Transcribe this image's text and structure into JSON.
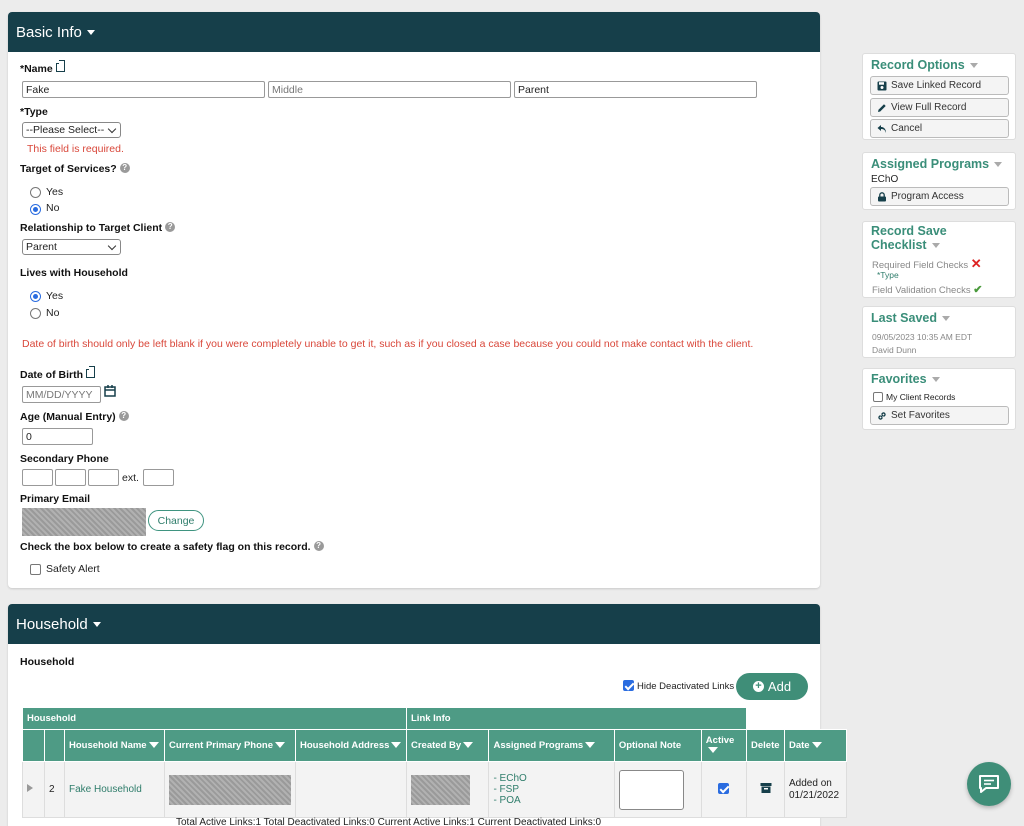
{
  "basic_info": {
    "title": "Basic Info",
    "name_label": "*Name",
    "first_value": "Fake",
    "middle_placeholder": "Middle",
    "last_value": "Parent",
    "type_label": "*Type",
    "type_value": "--Please Select--",
    "type_error": "This field is required.",
    "target_label": "Target of Services?",
    "target_yes": "Yes",
    "target_no": "No",
    "relationship_label": "Relationship to Target Client",
    "relationship_value": "Parent",
    "lives_label": "Lives with Household",
    "lives_yes": "Yes",
    "lives_no": "No",
    "dob_note": "Date of birth should only be left blank if you were completely unable to get it, such as if you closed a case because you could not make contact with the client.",
    "dob_label": "Date of Birth",
    "dob_placeholder": "MM/DD/YYYY",
    "age_label": "Age (Manual Entry)",
    "age_value": "0",
    "phone_label": "Secondary Phone",
    "ext_label": "ext.",
    "email_label": "Primary Email",
    "change_label": "Change",
    "safety_note": "Check the box below to create a safety flag on this record.",
    "safety_label": "Safety Alert"
  },
  "household": {
    "title": "Household",
    "subtitle": "Household",
    "hide_label": "Hide Deactivated Links",
    "add_label": "Add",
    "group_household": "Household",
    "group_link": "Link Info",
    "columns": {
      "name": "Household Name",
      "phone": "Current Primary Phone",
      "address": "Household Address",
      "created": "Created By",
      "programs": "Assigned Programs",
      "note": "Optional Note",
      "active": "Active",
      "delete": "Delete",
      "date": "Date"
    },
    "row": {
      "num": "2",
      "name": "Fake Household",
      "programs": [
        "- EChO",
        "- FSP",
        "- POA"
      ],
      "date": "Added on 01/21/2022"
    },
    "totals": "Total Active Links:1  Total Deactivated Links:0  Current Active Links:1  Current Deactivated Links:0"
  },
  "sidebar": {
    "record_options": {
      "title": "Record Options",
      "save": "Save Linked Record",
      "view": "View Full Record",
      "cancel": "Cancel"
    },
    "assigned_programs": {
      "title": "Assigned Programs",
      "program": "EChO",
      "access": "Program Access"
    },
    "checklist": {
      "title": "Record Save Checklist",
      "required": "Required Field Checks",
      "required_item": "*Type",
      "validation": "Field Validation Checks"
    },
    "last_saved": {
      "title": "Last Saved",
      "timestamp": "09/05/2023 10:35 AM EDT",
      "user": "David Dunn"
    },
    "favorites": {
      "title": "Favorites",
      "my_records": "My Client Records",
      "set": "Set Favorites"
    }
  }
}
